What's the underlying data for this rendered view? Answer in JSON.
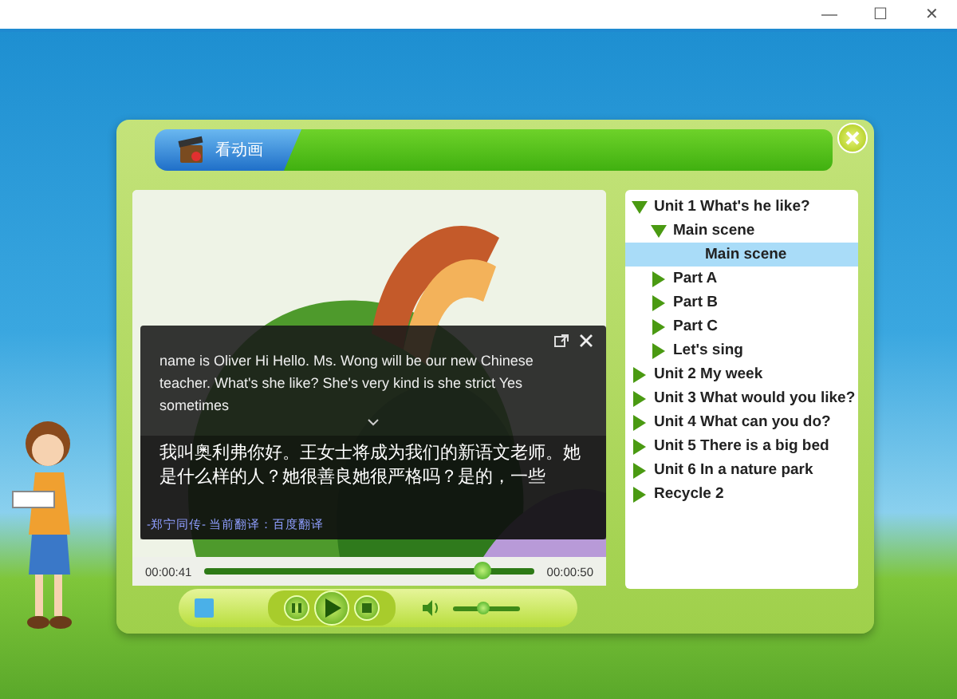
{
  "window": {
    "controls": [
      "—",
      "☐",
      "✕"
    ]
  },
  "player": {
    "tab": {
      "label": "看动画",
      "selected": true
    },
    "time_elapsed": "00:00:41",
    "time_total": "00:00:50",
    "progress": {
      "level": 0.84
    },
    "volume": {
      "level": 0.45
    },
    "playing": false
  },
  "tree": [
    {
      "label": "Unit 1 What's he like?",
      "expanded": true,
      "children": [
        {
          "label": "Main scene",
          "expanded": true,
          "children": [
            {
              "label": "Main scene",
              "selected": true
            }
          ]
        },
        {
          "label": "Part A",
          "expanded": false,
          "selected": false
        },
        {
          "label": "Part B",
          "expanded": false,
          "selected": false
        },
        {
          "label": "Part C",
          "expanded": false,
          "selected": false
        },
        {
          "label": "Let's sing",
          "expanded": false,
          "selected": false
        }
      ]
    },
    {
      "label": "Unit 2 My week",
      "expanded": false,
      "selected": false
    },
    {
      "label": "Unit 3 What would you like?",
      "expanded": false,
      "selected": false
    },
    {
      "label": "Unit 4 What can you do?",
      "expanded": false,
      "selected": false
    },
    {
      "label": "Unit 5 There is a big bed",
      "expanded": false,
      "selected": false
    },
    {
      "label": "Unit 6 In a nature park",
      "expanded": false,
      "selected": false
    },
    {
      "label": "Recycle 2",
      "expanded": false,
      "selected": false
    }
  ],
  "subtitle_popup": {
    "english": "name is Oliver Hi Hello. Ms. Wong will be our new Chinese teacher. What's she like? She's very kind is she strict Yes sometimes",
    "chinese": "我叫奥利弗你好。王女士将成为我们的新语文老师。她是什么样的人？她很善良她很严格吗？是的，一些",
    "footer": "-郑宁同传- 当前翻译：百度翻译"
  }
}
